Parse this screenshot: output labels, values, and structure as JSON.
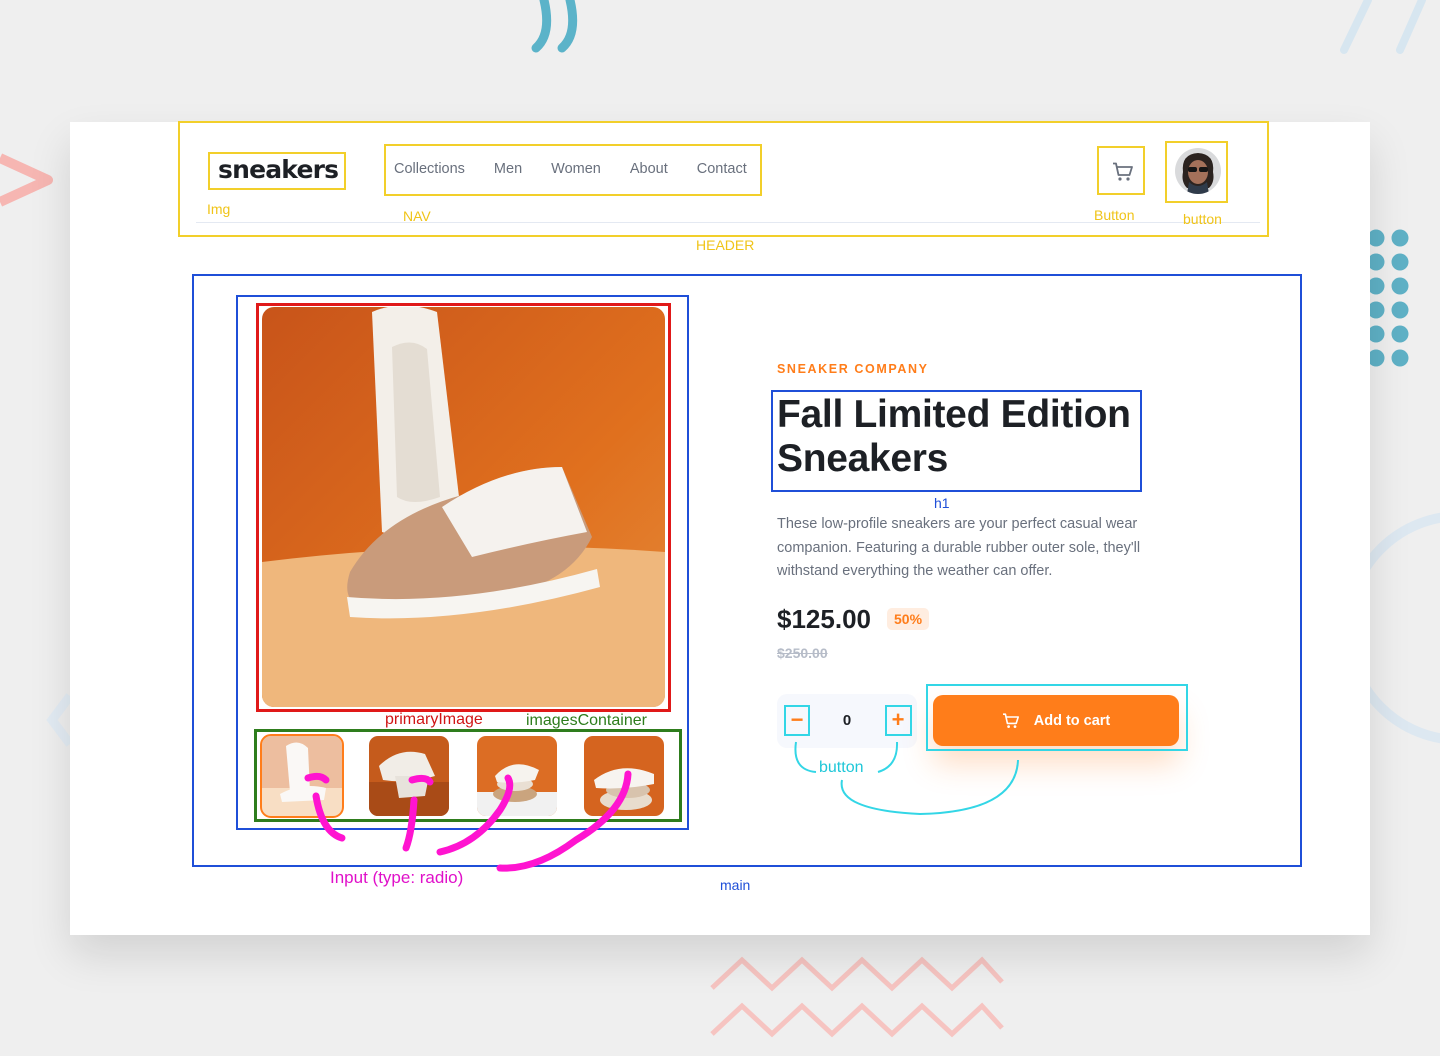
{
  "header": {
    "logo": "sneakers",
    "nav": [
      "Collections",
      "Men",
      "Women",
      "About",
      "Contact"
    ]
  },
  "product": {
    "company": "SNEAKER COMPANY",
    "title_line1": "Fall Limited Edition",
    "title_line2": "Sneakers",
    "description": "These low-profile sneakers are your perfect casual wear companion. Featuring a durable rubber outer sole, they'll withstand everything the weather can offer.",
    "price": "$125.00",
    "discount": "50%",
    "old_price": "$250.00",
    "quantity": "0",
    "minus": "−",
    "plus": "+",
    "add_to_cart": "Add to cart"
  },
  "annotations": {
    "img": "Img",
    "nav": "NAV",
    "button_cart": "Button",
    "button_avatar": "button",
    "header": "HEADER",
    "h1": "h1",
    "primary_image": "primaryImage",
    "images_container": "imagesContainer",
    "button_qty": "button",
    "input_radio": "Input (type: radio)",
    "main": "main"
  },
  "colors": {
    "accent": "#ff7d1a",
    "annotation_header": "#f2cf2a",
    "annotation_main": "#1f4fd8",
    "annotation_primary_image": "#e01919",
    "annotation_images_container": "#2e7d1d",
    "annotation_buttons": "#33d6e6",
    "annotation_radio": "#e010c9"
  },
  "icons": {
    "cart": "cart-icon",
    "avatar": "avatar-image",
    "minus": "minus-icon",
    "plus": "plus-icon"
  }
}
